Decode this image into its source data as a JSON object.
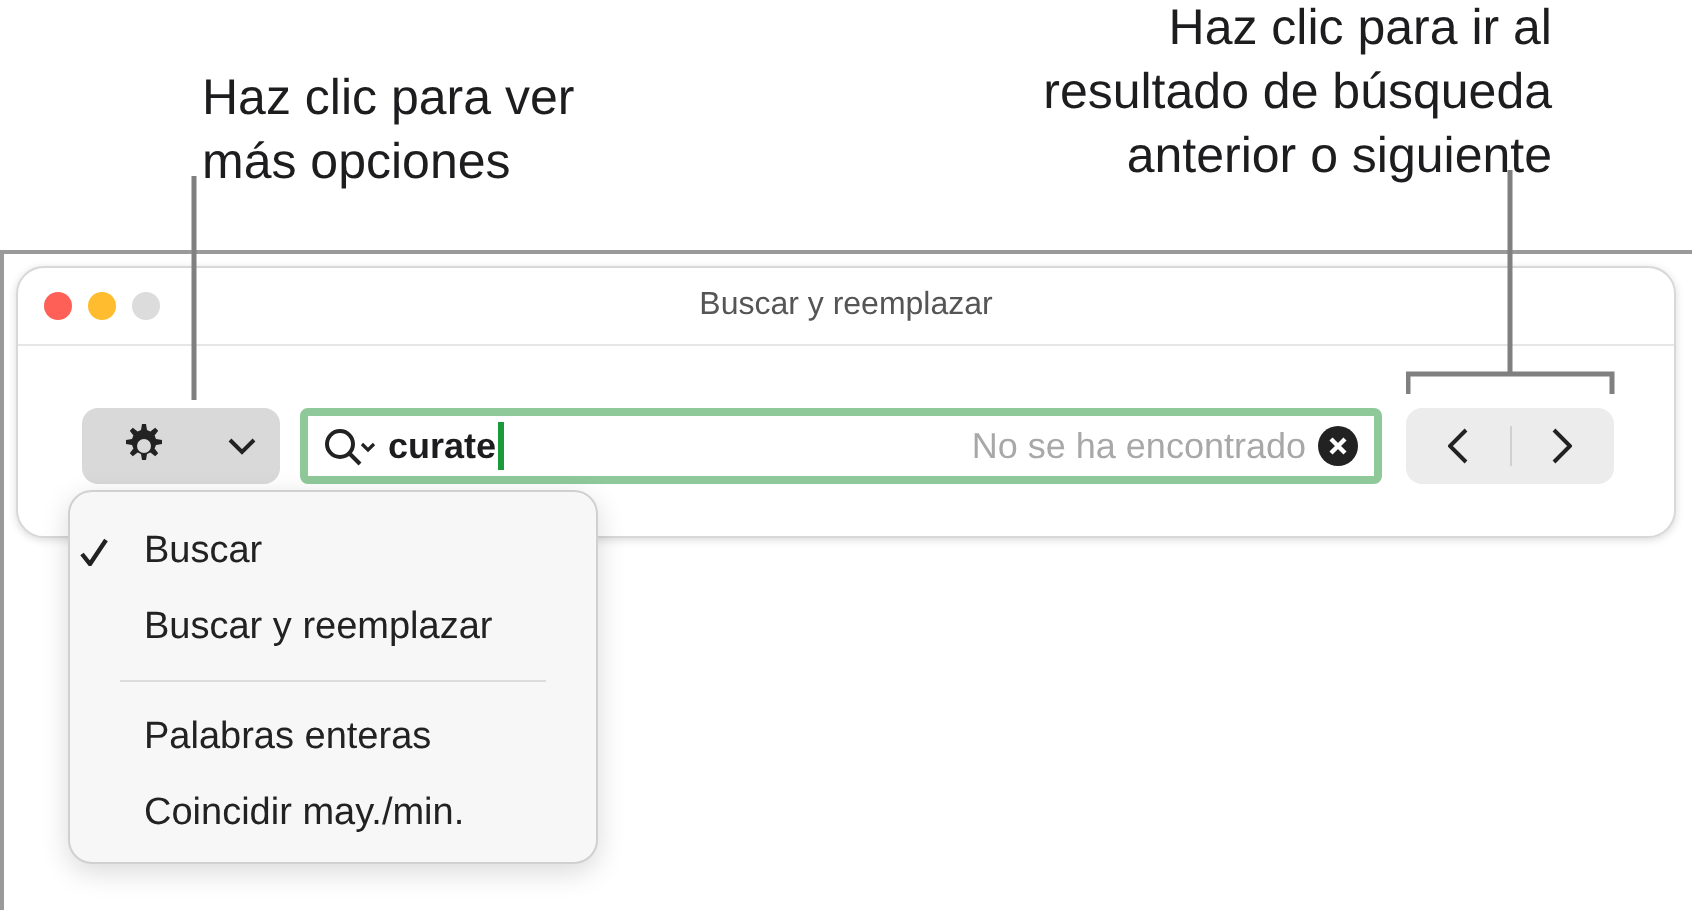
{
  "callouts": [
    {
      "text": "Haz clic para ver\nmás opciones"
    },
    {
      "text": "Haz clic para ir al\nresultado de búsqueda\nanterior o siguiente"
    }
  ],
  "window": {
    "title": "Buscar y reemplazar"
  },
  "search": {
    "value": "curate",
    "status": "No se ha encontrado"
  },
  "menu": {
    "sections": [
      [
        {
          "label": "Buscar",
          "checked": true
        },
        {
          "label": "Buscar y reemplazar",
          "checked": false
        }
      ],
      [
        {
          "label": "Palabras enteras",
          "checked": false
        },
        {
          "label": "Coincidir may./min.",
          "checked": false
        }
      ]
    ]
  }
}
